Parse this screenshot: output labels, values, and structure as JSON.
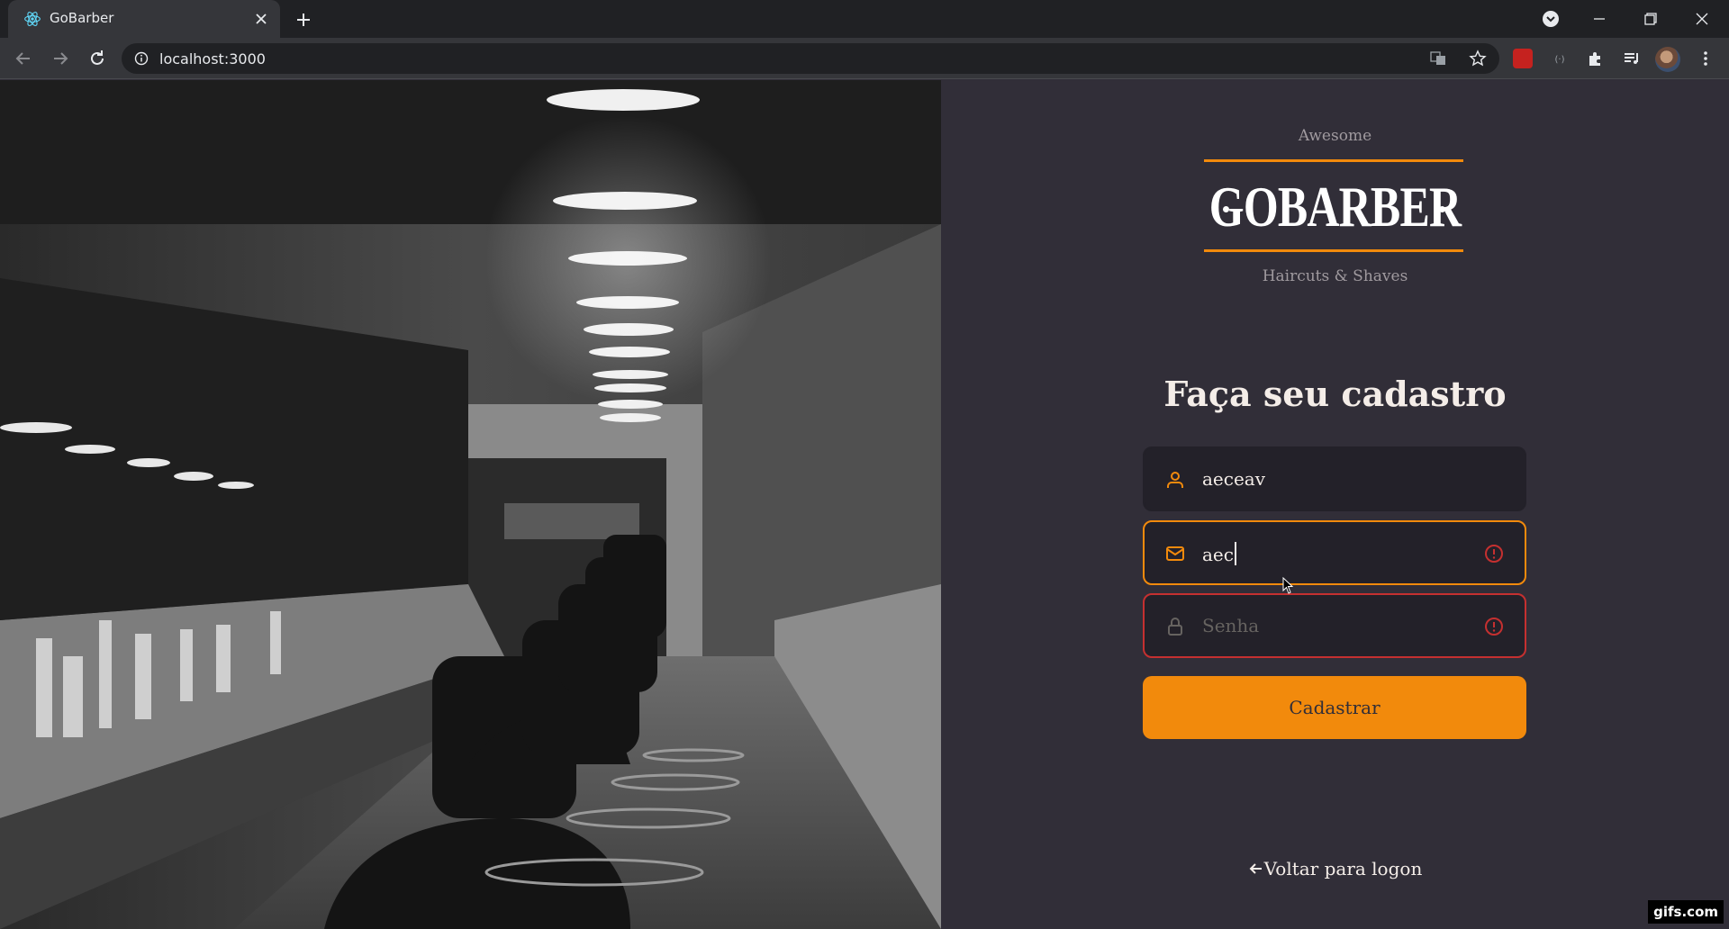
{
  "browser": {
    "tab_title": "GoBarber",
    "url": "localhost:3000"
  },
  "brand": {
    "top": "Awesome",
    "name": "GOBARBER",
    "sub": "Haircuts & Shaves"
  },
  "form": {
    "heading": "Faça seu cadastro",
    "name_value": "aeceav",
    "email_value": "aec",
    "password_placeholder": "Senha",
    "submit_label": "Cadastrar"
  },
  "back_link": "Voltar para logon",
  "watermark": "gifs.com",
  "colors": {
    "accent": "#f28a0c",
    "error": "#c53030",
    "background": "#312e38",
    "input_bg": "#232129",
    "text": "#f4ede8",
    "muted": "#666360"
  },
  "icons": {
    "name_field": "user-icon",
    "email_field": "mail-icon",
    "password_field": "lock-icon",
    "field_error": "alert-circle-icon",
    "back": "arrow-left-icon"
  }
}
